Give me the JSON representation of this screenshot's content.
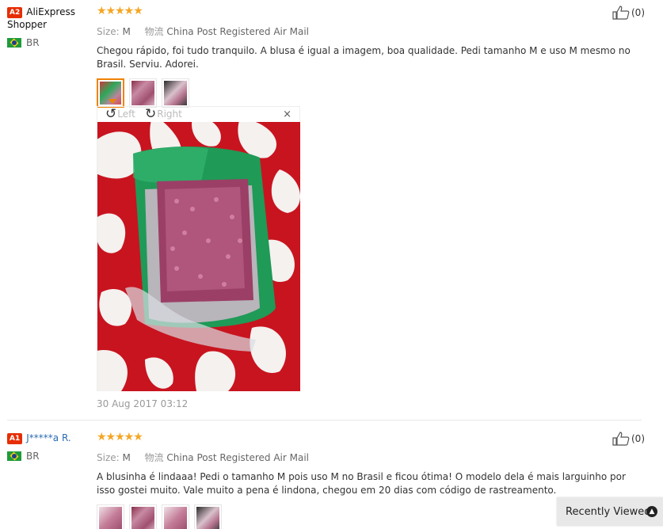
{
  "reviews": [
    {
      "badge": "A2",
      "user_name": "AliExpress Shopper",
      "country": "BR",
      "stars": "★★★★★",
      "size_label": "Size:",
      "size_value": "M",
      "shipping_label": "物流",
      "shipping_value": "China Post Registered Air Mail",
      "text": "Chegou rápido, foi tudo tranquilo. A blusa é igual a imagem, boa qualidade. Pedi tamanho M e uso M mesmo no Brasil. Serviu. Adorei.",
      "date": "30 Aug 2017 03:12",
      "likes": "(0)",
      "viewer": {
        "left_label": "Left",
        "right_label": "Right",
        "close": "×"
      }
    },
    {
      "badge": "A1",
      "user_name": "J*****a R.",
      "country": "BR",
      "stars": "★★★★★",
      "size_label": "Size:",
      "size_value": "M",
      "shipping_label": "物流",
      "shipping_value": "China Post Registered Air Mail",
      "text": "A blusinha é lindaaa! Pedi o tamanho M pois uso M no Brasil e ficou ótima! O modelo dela é mais larguinho por isso gostei muito. Vale muito a pena é lindona, chegou em 20 dias com código de rastreamento.",
      "likes": "(0)"
    }
  ],
  "recently_viewed": {
    "label": "Recently Viewed",
    "icon": "chevron-up-icon"
  },
  "colors": {
    "badge": "#e62e04",
    "stars": "#f5a623",
    "active_thumb": "#f08200",
    "link": "#2b6cb0"
  }
}
